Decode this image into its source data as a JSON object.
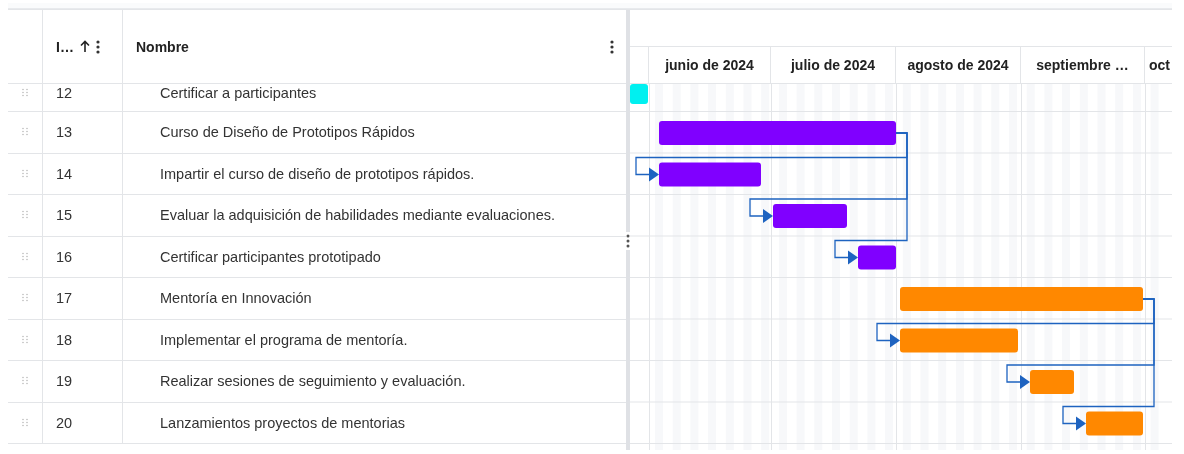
{
  "columns": [
    {
      "label": "I…",
      "sorted": true
    },
    {
      "label": "Nombre",
      "sorted": false
    }
  ],
  "months": [
    "junio de 2024",
    "julio de 2024",
    "agosto de 2024",
    "septiembre …",
    "oct"
  ],
  "rows": [
    {
      "id": "12",
      "name": "Certificar a participantes",
      "color": "#00f0f0"
    },
    {
      "id": "13",
      "name": "Curso de Diseño de Prototipos Rápidos",
      "color": "#8000ff"
    },
    {
      "id": "14",
      "name": "Impartir el curso de diseño de prototipos rápidos.",
      "color": "#8000ff"
    },
    {
      "id": "15",
      "name": "Evaluar la adquisición de habilidades mediante evaluaciones.",
      "color": "#8000ff"
    },
    {
      "id": "16",
      "name": "Certificar participantes prototipado",
      "color": "#8000ff"
    },
    {
      "id": "17",
      "name": "Mentoría en Innovación",
      "color": "#ff8800"
    },
    {
      "id": "18",
      "name": "Implementar el programa de mentoría.",
      "color": "#ff8800"
    },
    {
      "id": "19",
      "name": "Realizar sesiones de seguimiento y evaluación.",
      "color": "#ff8800"
    },
    {
      "id": "20",
      "name": "Lanzamientos proyectos de mentorias",
      "color": "#ff8800"
    }
  ]
}
